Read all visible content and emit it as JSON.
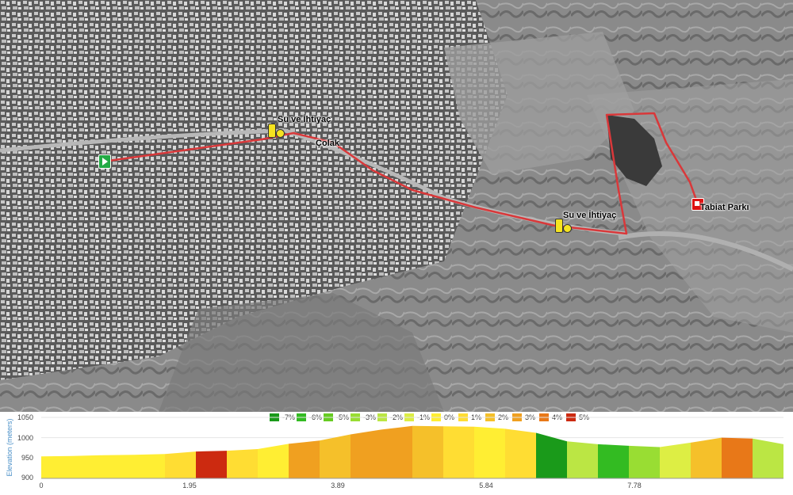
{
  "map": {
    "start_marker": {
      "icon": "play-flag-icon",
      "color": "#22aa44"
    },
    "water_markers": [
      {
        "label": "Su ve İhtiyaç",
        "icon": "water-bottle-icon"
      },
      {
        "label": "Su ve İhtiyaç",
        "icon": "water-bottle-icon"
      }
    ],
    "waypoint_label": "Çolak",
    "finish_marker": {
      "label": "Tabiat Parkı",
      "icon": "finish-flag-icon",
      "color": "#dd1111"
    },
    "route_color": "#d9383a"
  },
  "elevation": {
    "ylabel": "Elevation (meters)",
    "legend": [
      {
        "label": "-7%",
        "color": "#1a9a1a"
      },
      {
        "label": "-6%",
        "color": "#33bb22"
      },
      {
        "label": "-5%",
        "color": "#66cc22"
      },
      {
        "label": "-3%",
        "color": "#99dd33"
      },
      {
        "label": "-2%",
        "color": "#bbe644"
      },
      {
        "label": "-1%",
        "color": "#ddee44"
      },
      {
        "label": "0%",
        "color": "#ffee33"
      },
      {
        "label": "1%",
        "color": "#ffdd33"
      },
      {
        "label": "2%",
        "color": "#f5c02a"
      },
      {
        "label": "3%",
        "color": "#f0a020"
      },
      {
        "label": "4%",
        "color": "#e87818"
      },
      {
        "label": "5%",
        "color": "#cc2a10"
      }
    ],
    "yticks": [
      "1050",
      "1000",
      "950",
      "900"
    ],
    "xticks": [
      "0",
      "1.95",
      "3.89",
      "5.84",
      "7.78"
    ]
  },
  "chart_data": {
    "type": "area",
    "ylabel": "Elevation (meters)",
    "xlabel": "",
    "ylim": [
      900,
      1050
    ],
    "xlim": [
      0,
      9.6
    ],
    "xticks": [
      0,
      1.95,
      3.89,
      5.84,
      7.78
    ],
    "x": [
      0,
      0.4,
      0.8,
      1.2,
      1.6,
      2.0,
      2.4,
      2.8,
      3.2,
      3.6,
      4.0,
      4.4,
      4.8,
      5.2,
      5.6,
      6.0,
      6.4,
      6.8,
      7.2,
      7.6,
      8.0,
      8.4,
      8.8,
      9.2,
      9.6
    ],
    "y": [
      954,
      955,
      957,
      958,
      960,
      966,
      968,
      972,
      985,
      993,
      1008,
      1020,
      1029,
      1028,
      1027,
      1022,
      1012,
      991,
      984,
      980,
      977,
      988,
      1000,
      998,
      984
    ],
    "grades": [
      "0%",
      "0%",
      "0%",
      "0%",
      "1%",
      "5%",
      "1%",
      "0%",
      "3%",
      "2%",
      "3%",
      "3%",
      "2%",
      "1%",
      "0%",
      "1%",
      "-7%",
      "-2%",
      "-6%",
      "-3%",
      "-1%",
      "2%",
      "4%",
      "-2%",
      "-3%"
    ]
  }
}
